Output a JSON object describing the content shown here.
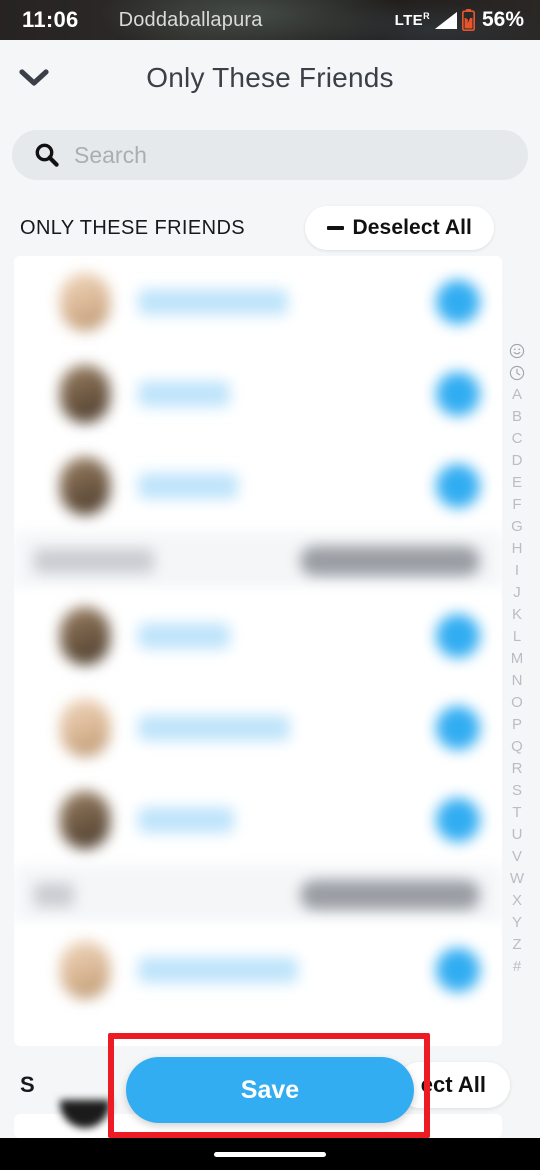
{
  "statusbar": {
    "time": "11:06",
    "carrier": "Doddaballapura",
    "network": "LTE",
    "roaming": "R",
    "battery_percent": "56%",
    "signal_icon": "signal-bars-icon",
    "battery_icon": "battery-icon",
    "battery_color": "#E8552C"
  },
  "header": {
    "back_icon": "chevron-down-icon",
    "title": "Only These Friends"
  },
  "search": {
    "icon": "search-icon",
    "placeholder": "Search",
    "value": ""
  },
  "section": {
    "label": "ONLY THESE FRIENDS",
    "deselect_label": "Deselect All",
    "deselect_icon": "minus-icon"
  },
  "list": {
    "rows": [
      {
        "avatar_tone": "light",
        "name_width": 150,
        "selected": true
      },
      {
        "avatar_tone": "dark",
        "name_width": 92,
        "selected": true
      },
      {
        "avatar_tone": "dark",
        "name_width": 100,
        "selected": true
      },
      {
        "avatar_tone": "dark",
        "name_width": 92,
        "selected": true
      },
      {
        "avatar_tone": "light",
        "name_width": 152,
        "selected": true
      },
      {
        "avatar_tone": "dark",
        "name_width": 96,
        "selected": true
      },
      {
        "avatar_tone": "light",
        "name_width": 160,
        "selected": true
      }
    ],
    "dividers_hidden_label": "blurred section header",
    "check_color": "#32ADF2"
  },
  "alpha_index": {
    "items": [
      "smiley-icon",
      "clock-icon",
      "A",
      "B",
      "C",
      "D",
      "E",
      "F",
      "G",
      "H",
      "I",
      "J",
      "K",
      "L",
      "M",
      "N",
      "O",
      "P",
      "Q",
      "R",
      "S",
      "T",
      "U",
      "V",
      "W",
      "X",
      "Y",
      "Z",
      "#"
    ]
  },
  "bottom_section": {
    "letter": "S",
    "button_label": "ect All"
  },
  "save": {
    "label": "Save",
    "color": "#32ADF2"
  },
  "annotation": {
    "color": "#ED1C24",
    "target": "save-button"
  },
  "navbar": {
    "home_indicator": "home-indicator"
  }
}
